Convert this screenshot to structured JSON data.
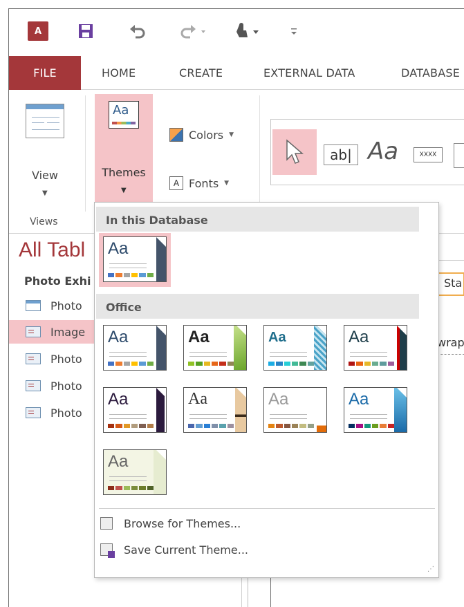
{
  "quick_access": {
    "app_icon": "access-logo-icon",
    "app_letters": "A",
    "buttons": [
      "save-icon",
      "undo-icon",
      "redo-icon",
      "touch-mode-icon",
      "customize-toolbar-icon"
    ]
  },
  "tabs": [
    {
      "label": "FILE",
      "active": true
    },
    {
      "label": "HOME"
    },
    {
      "label": "CREATE"
    },
    {
      "label": "EXTERNAL DATA"
    },
    {
      "label": "DATABASE"
    }
  ],
  "ribbon": {
    "view_label": "View",
    "views_group_label": "Views",
    "themes_label": "Themes",
    "colors_label": "Colors",
    "fonts_label": "Fonts",
    "fonts_icon_letter": "A",
    "gallery": {
      "textbox_label": "ab|",
      "label_aa": "Aa",
      "button_label": "XXXX"
    }
  },
  "nav_pane": {
    "title": "All Tabl",
    "group": "Photo Exhi",
    "items": [
      {
        "label": "Photo",
        "type": "table"
      },
      {
        "label": "Image",
        "type": "form",
        "selected": true
      },
      {
        "label": "Photo",
        "type": "form"
      },
      {
        "label": "Photo",
        "type": "form"
      },
      {
        "label": "Photo",
        "type": "form"
      }
    ]
  },
  "document_area": {
    "field_label": "Sta",
    "wrap_text": "wrap"
  },
  "themes_dropdown": {
    "in_database_header": "In this Database",
    "office_header": "Office",
    "theme_sample_text": "Aa",
    "browse_label": "Browse for Themes...",
    "save_label": "Save Current Theme..."
  },
  "colors": {
    "accent": "#a4373a",
    "highlight": "#f5c4c8"
  }
}
